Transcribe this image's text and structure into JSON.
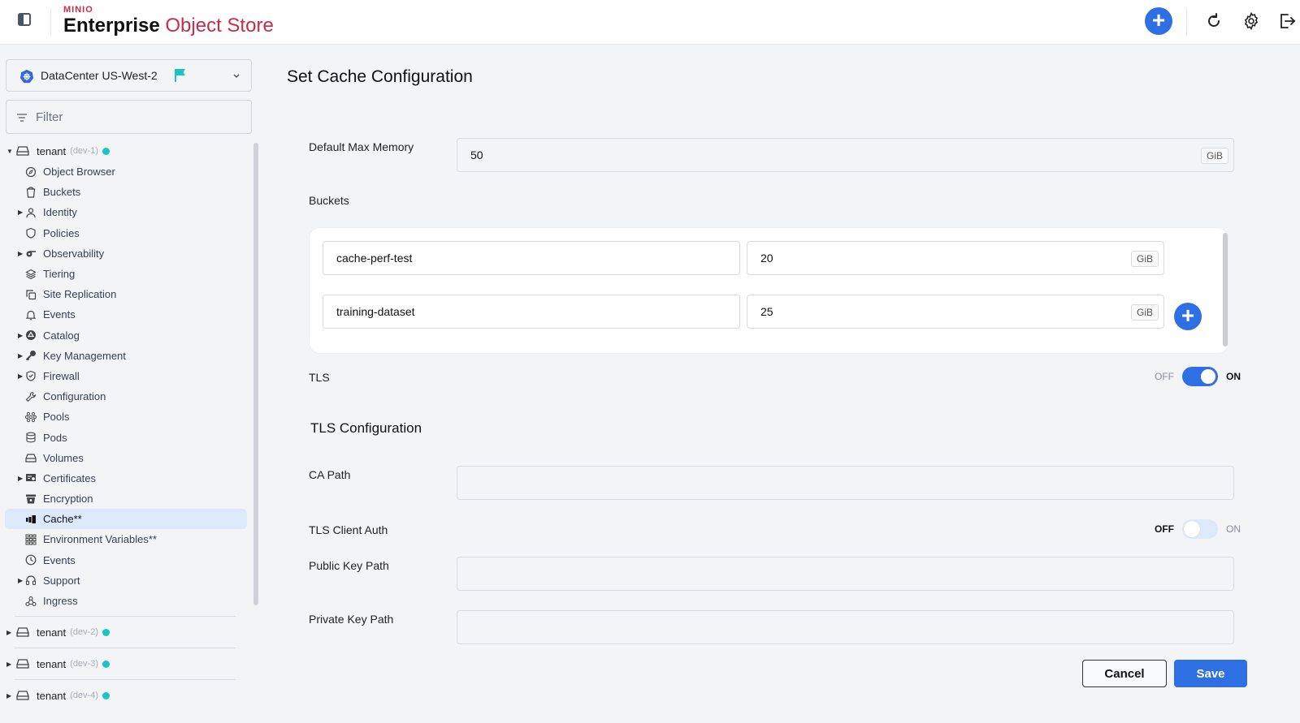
{
  "header": {
    "brand_small": "MINIO",
    "brand_bold": "Enterprise",
    "brand_light": "Object Store",
    "accent_color": "#c72c48",
    "primary_color": "#2f6fe4",
    "icons": [
      "sidebar-toggle-icon",
      "add-icon",
      "refresh-icon",
      "settings-icon",
      "logout-icon"
    ]
  },
  "sidebar": {
    "datacenter": "DataCenter US-West-2",
    "filter_placeholder": "Filter",
    "tenants": [
      {
        "name": "tenant",
        "sub": "(dev-1)",
        "expanded": true,
        "status_color": "#19c4c4",
        "items": [
          {
            "label": "Object Browser",
            "icon": "compass-icon",
            "expandable": false
          },
          {
            "label": "Buckets",
            "icon": "bucket-icon",
            "expandable": false
          },
          {
            "label": "Identity",
            "icon": "user-icon",
            "expandable": true
          },
          {
            "label": "Policies",
            "icon": "shield-icon",
            "expandable": false
          },
          {
            "label": "Observability",
            "icon": "observability-icon",
            "expandable": true
          },
          {
            "label": "Tiering",
            "icon": "layers-icon",
            "expandable": false
          },
          {
            "label": "Site Replication",
            "icon": "copy-icon",
            "expandable": false
          },
          {
            "label": "Events",
            "icon": "bell-icon",
            "expandable": false
          },
          {
            "label": "Catalog",
            "icon": "catalog-icon",
            "expandable": true
          },
          {
            "label": "Key Management",
            "icon": "key-icon",
            "expandable": true
          },
          {
            "label": "Firewall",
            "icon": "shield-check-icon",
            "expandable": true
          },
          {
            "label": "Configuration",
            "icon": "wrench-icon",
            "expandable": false
          },
          {
            "label": "Pools",
            "icon": "pools-icon",
            "expandable": false
          },
          {
            "label": "Pods",
            "icon": "database-icon",
            "expandable": false
          },
          {
            "label": "Volumes",
            "icon": "drive-icon",
            "expandable": false
          },
          {
            "label": "Certificates",
            "icon": "certificate-icon",
            "expandable": true
          },
          {
            "label": "Encryption",
            "icon": "encryption-icon",
            "expandable": false
          },
          {
            "label": "Cache**",
            "icon": "cache-icon",
            "expandable": false,
            "active": true
          },
          {
            "label": "Environment Variables**",
            "icon": "grid-icon",
            "expandable": false
          },
          {
            "label": "Events",
            "icon": "clock-icon",
            "expandable": false
          },
          {
            "label": "Support",
            "icon": "headset-icon",
            "expandable": true
          },
          {
            "label": "Ingress",
            "icon": "webhook-icon",
            "expandable": false
          }
        ]
      },
      {
        "name": "tenant",
        "sub": "(dev-2)",
        "expanded": false,
        "status_color": "#19c4c4"
      },
      {
        "name": "tenant",
        "sub": "(dev-3)",
        "expanded": false,
        "status_color": "#19c4c4"
      },
      {
        "name": "tenant",
        "sub": "(dev-4)",
        "expanded": false,
        "status_color": "#19c4c4"
      }
    ]
  },
  "main": {
    "title": "Set Cache Configuration",
    "default_max_memory": {
      "label": "Default Max Memory",
      "value": "50",
      "unit": "GiB"
    },
    "buckets": {
      "label": "Buckets",
      "rows": [
        {
          "name": "cache-perf-test",
          "size": "20",
          "unit": "GiB"
        },
        {
          "name": "training-dataset",
          "size": "25",
          "unit": "GiB"
        }
      ]
    },
    "tls": {
      "label": "TLS",
      "off_label": "OFF",
      "on_label": "ON",
      "enabled": true
    },
    "tls_config": {
      "title": "TLS Configuration",
      "ca_path": {
        "label": "CA Path",
        "value": ""
      },
      "client_auth": {
        "label": "TLS Client Auth",
        "off_label": "OFF",
        "on_label": "ON",
        "enabled": false
      },
      "public_key_path": {
        "label": "Public Key Path",
        "value": ""
      },
      "private_key_path": {
        "label": "Private Key Path",
        "value": ""
      }
    },
    "actions": {
      "cancel": "Cancel",
      "save": "Save"
    }
  }
}
